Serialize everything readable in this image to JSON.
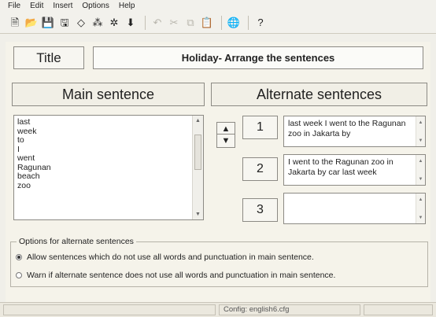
{
  "menu": [
    "File",
    "Edit",
    "Insert",
    "Options",
    "Help"
  ],
  "toolbar": {
    "buttons": [
      {
        "name": "new-icon",
        "glyph": "🗎",
        "disabled": false
      },
      {
        "name": "open-icon",
        "glyph": "📂",
        "disabled": false
      },
      {
        "name": "save-icon",
        "glyph": "💾",
        "disabled": false
      },
      {
        "name": "save-as-icon",
        "glyph": "🖫",
        "disabled": false
      },
      {
        "name": "shape-icon",
        "glyph": "◇",
        "disabled": false
      },
      {
        "name": "scatter-icon",
        "glyph": "⁂",
        "disabled": false
      },
      {
        "name": "shuffle-icon",
        "glyph": "✲",
        "disabled": false
      },
      {
        "name": "download-icon",
        "glyph": "⬇",
        "disabled": false
      },
      {
        "name": "sep"
      },
      {
        "name": "undo-icon",
        "glyph": "↶",
        "disabled": true
      },
      {
        "name": "cut-icon",
        "glyph": "✂",
        "disabled": true
      },
      {
        "name": "copy-icon",
        "glyph": "⧉",
        "disabled": true
      },
      {
        "name": "paste-icon",
        "glyph": "📋",
        "disabled": true
      },
      {
        "name": "sep"
      },
      {
        "name": "web-icon",
        "glyph": "🌐",
        "disabled": false
      },
      {
        "name": "sep"
      },
      {
        "name": "help-icon",
        "glyph": "?",
        "disabled": false
      }
    ]
  },
  "title": {
    "label": "Title",
    "value": "Holiday- Arrange the sentences"
  },
  "main": {
    "header": "Main sentence",
    "words": [
      "last",
      "week",
      "to",
      "I",
      "went",
      "Ragunan",
      "beach",
      "zoo"
    ]
  },
  "alt": {
    "header": "Alternate sentences",
    "numbers": [
      "1",
      "2",
      "3"
    ],
    "sentences": [
      "last week I went to the Ragunan zoo in Jakarta by",
      "I went to the Ragunan zoo in Jakarta by car last week",
      ""
    ]
  },
  "options": {
    "legend": "Options for alternate sentences",
    "choices": [
      {
        "label": "Allow sentences which do not use all words and punctuation in main sentence.",
        "selected": true
      },
      {
        "label": "Warn if alternate sentence does not use all words and punctuation in main sentence.",
        "selected": false
      }
    ]
  },
  "status": {
    "config": "Config: english6.cfg"
  }
}
